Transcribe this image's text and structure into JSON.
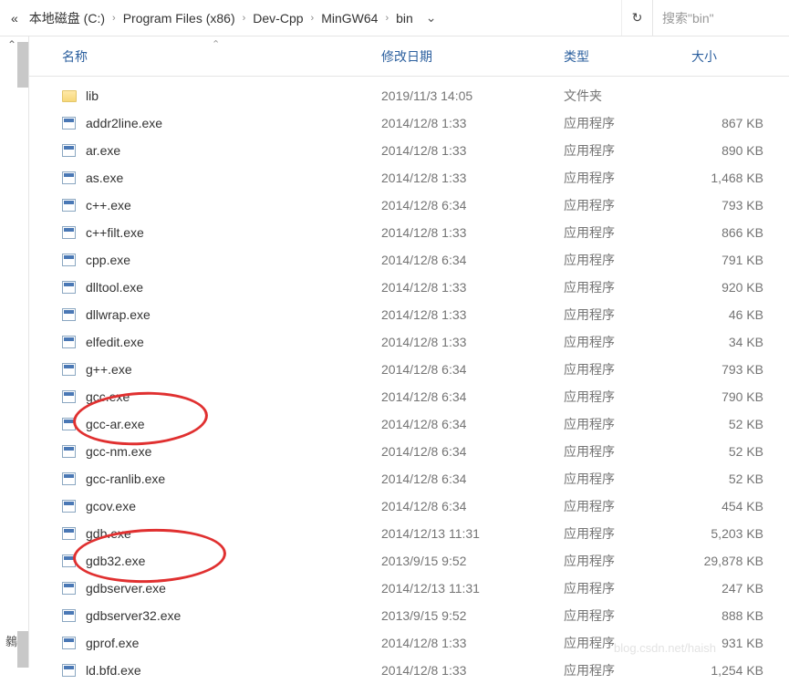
{
  "breadcrumb": {
    "truncate": "«",
    "items": [
      "本地磁盘 (C:)",
      "Program Files (x86)",
      "Dev-Cpp",
      "MinGW64",
      "bin"
    ]
  },
  "search": {
    "placeholder": "搜索\"bin\""
  },
  "columns": {
    "name": "名称",
    "date": "修改日期",
    "type": "类型",
    "size": "大小"
  },
  "typeLabels": {
    "folder": "文件夹",
    "exe": "应用程序"
  },
  "files": [
    {
      "name": "lib",
      "date": "2019/11/3 14:05",
      "kind": "folder",
      "size": ""
    },
    {
      "name": "addr2line.exe",
      "date": "2014/12/8 1:33",
      "kind": "exe",
      "size": "867 KB"
    },
    {
      "name": "ar.exe",
      "date": "2014/12/8 1:33",
      "kind": "exe",
      "size": "890 KB"
    },
    {
      "name": "as.exe",
      "date": "2014/12/8 1:33",
      "kind": "exe",
      "size": "1,468 KB"
    },
    {
      "name": "c++.exe",
      "date": "2014/12/8 6:34",
      "kind": "exe",
      "size": "793 KB"
    },
    {
      "name": "c++filt.exe",
      "date": "2014/12/8 1:33",
      "kind": "exe",
      "size": "866 KB"
    },
    {
      "name": "cpp.exe",
      "date": "2014/12/8 6:34",
      "kind": "exe",
      "size": "791 KB"
    },
    {
      "name": "dlltool.exe",
      "date": "2014/12/8 1:33",
      "kind": "exe",
      "size": "920 KB"
    },
    {
      "name": "dllwrap.exe",
      "date": "2014/12/8 1:33",
      "kind": "exe",
      "size": "46 KB"
    },
    {
      "name": "elfedit.exe",
      "date": "2014/12/8 1:33",
      "kind": "exe",
      "size": "34 KB"
    },
    {
      "name": "g++.exe",
      "date": "2014/12/8 6:34",
      "kind": "exe",
      "size": "793 KB"
    },
    {
      "name": "gcc.exe",
      "date": "2014/12/8 6:34",
      "kind": "exe",
      "size": "790 KB"
    },
    {
      "name": "gcc-ar.exe",
      "date": "2014/12/8 6:34",
      "kind": "exe",
      "size": "52 KB"
    },
    {
      "name": "gcc-nm.exe",
      "date": "2014/12/8 6:34",
      "kind": "exe",
      "size": "52 KB"
    },
    {
      "name": "gcc-ranlib.exe",
      "date": "2014/12/8 6:34",
      "kind": "exe",
      "size": "52 KB"
    },
    {
      "name": "gcov.exe",
      "date": "2014/12/8 6:34",
      "kind": "exe",
      "size": "454 KB"
    },
    {
      "name": "gdb.exe",
      "date": "2014/12/13 11:31",
      "kind": "exe",
      "size": "5,203 KB"
    },
    {
      "name": "gdb32.exe",
      "date": "2013/9/15 9:52",
      "kind": "exe",
      "size": "29,878 KB"
    },
    {
      "name": "gdbserver.exe",
      "date": "2014/12/13 11:31",
      "kind": "exe",
      "size": "247 KB"
    },
    {
      "name": "gdbserver32.exe",
      "date": "2013/9/15 9:52",
      "kind": "exe",
      "size": "888 KB"
    },
    {
      "name": "gprof.exe",
      "date": "2014/12/8 1:33",
      "kind": "exe",
      "size": "931 KB"
    },
    {
      "name": "ld.bfd.exe",
      "date": "2014/12/8 1:33",
      "kind": "exe",
      "size": "1,254 KB"
    }
  ],
  "watermark": "blog.csdn.net/haish"
}
